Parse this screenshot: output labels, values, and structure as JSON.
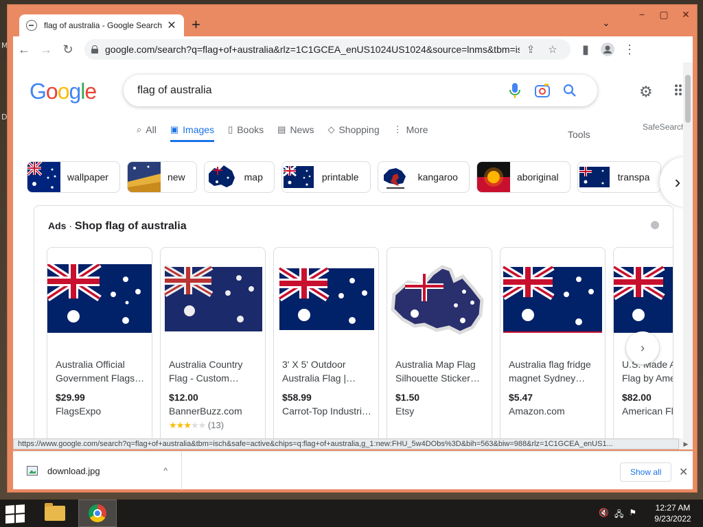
{
  "desktop": {
    "marks": [
      "M",
      "D"
    ]
  },
  "window": {
    "tab": {
      "title": "flag of australia - Google Search",
      "close": "✕"
    },
    "newtab": "+",
    "tab_dropdown": "⌄",
    "controls": {
      "minimize": "−",
      "maximize": "▢",
      "close": "✕"
    }
  },
  "toolbar": {
    "back": "←",
    "forward": "→",
    "reload": "↻",
    "url": "google.com/search?q=flag+of+australia&rlz=1C1GCEA_enUS1024US1024&source=lnms&tbm=isch&sa=...",
    "share": "⇪",
    "bookmark": "☆",
    "sidepanel": "▮",
    "menu": "⋮"
  },
  "google": {
    "logo": [
      "G",
      "o",
      "o",
      "g",
      "l",
      "e"
    ],
    "logo_colors": [
      "#4285f4",
      "#ea4335",
      "#fbbc05",
      "#4285f4",
      "#34a853",
      "#ea4335"
    ],
    "search_query": "flag of australia",
    "settings": "⚙",
    "tabs": [
      {
        "icon": "⌕",
        "label": "All"
      },
      {
        "icon": "▣",
        "label": "Images"
      },
      {
        "icon": "▯",
        "label": "Books"
      },
      {
        "icon": "▤",
        "label": "News"
      },
      {
        "icon": "◇",
        "label": "Shopping"
      },
      {
        "icon": "⋮",
        "label": "More"
      }
    ],
    "tools": "Tools",
    "safesearch": "SafeSearch",
    "chips": [
      "wallpaper",
      "new",
      "map",
      "printable",
      "kangaroo",
      "aboriginal",
      "transpa"
    ],
    "chips_next": "›",
    "ads": {
      "label": "Ads",
      "separator": "·",
      "title": "Shop flag of australia",
      "next": "›",
      "products": [
        {
          "title": "Australia Official Government Flags…",
          "price": "$29.99",
          "store": "FlagsExpo"
        },
        {
          "title": "Australia Country Flag - Custom…",
          "price": "$12.00",
          "store": "BannerBuzz.com",
          "rating_stars": 3,
          "rating_count": "(13)"
        },
        {
          "title": "3' X 5' Outdoor Australia Flag |…",
          "price": "$58.99",
          "store": "Carrot-Top Industri…"
        },
        {
          "title": "Australia Map Flag Silhouette Sticker…",
          "price": "$1.50",
          "store": "Etsy"
        },
        {
          "title": "Australia flag fridge magnet Sydney…",
          "price": "$5.47",
          "store": "Amazon.com"
        },
        {
          "title": "U.S. Made Australia Flag by American…",
          "price": "$82.00",
          "store": "American Fl…"
        }
      ]
    }
  },
  "statusbar": "https://www.google.com/search?q=flag+of+australia&tbm=isch&safe=active&chips=q:flag+of+australia,g_1:new:FHU_5w4DObs%3D&bih=563&biw=988&rlz=1C1GCEA_enUS1...",
  "downloads": {
    "file": "download.jpg",
    "caret": "^",
    "show_all": "Show all",
    "close": "✕"
  },
  "taskbar": {
    "tray": [
      "🔇",
      "🖧",
      "⚑"
    ],
    "time": "12:27 AM",
    "date": "9/23/2022"
  }
}
